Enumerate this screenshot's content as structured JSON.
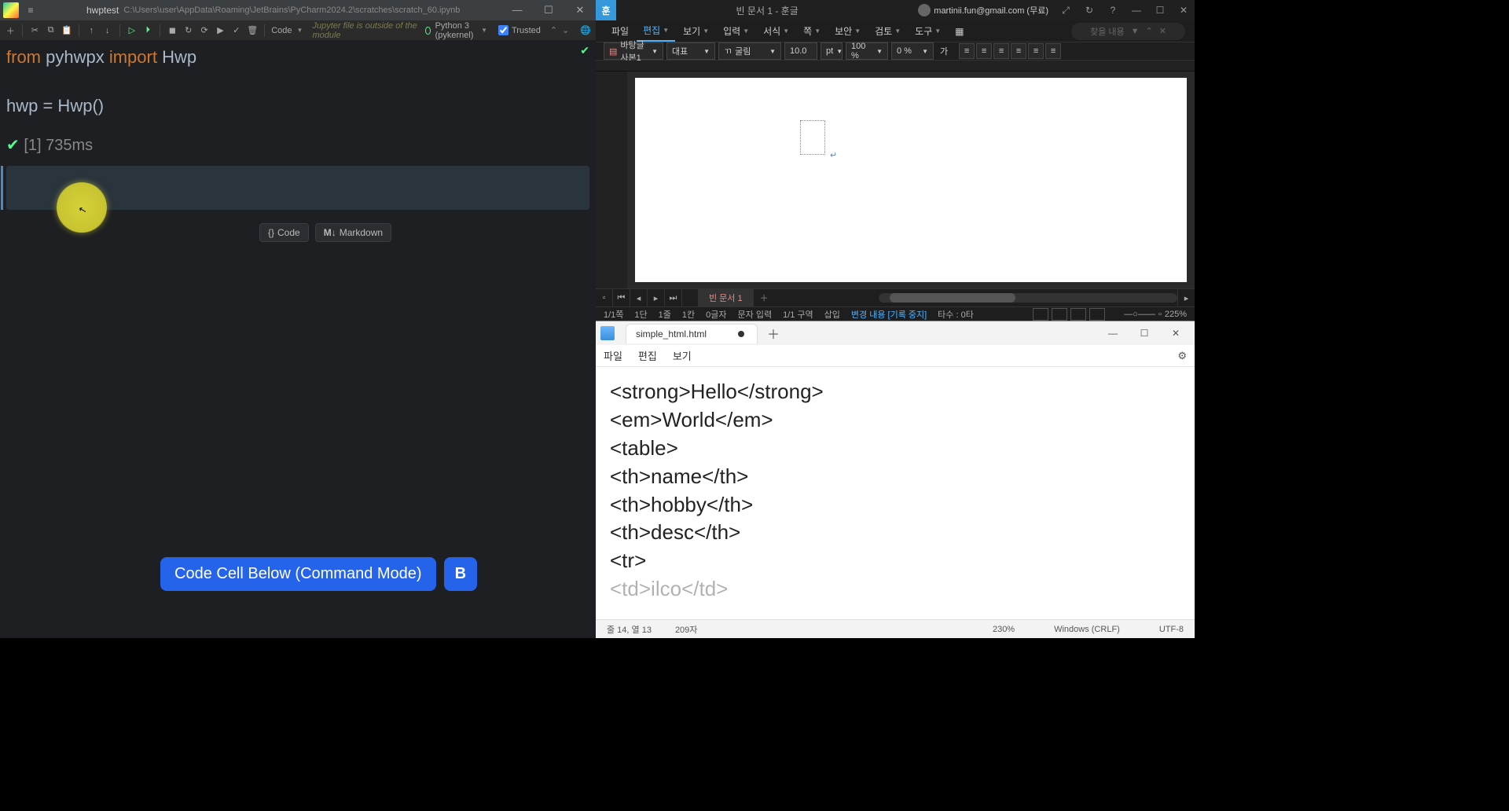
{
  "pycharm": {
    "tab_name": "hwptest",
    "path": "C:\\Users\\user\\AppData\\Roaming\\JetBrains\\PyCharm2024.2\\scratches\\scratch_60.ipynb",
    "toolbar": {
      "code_dropdown": "Code",
      "warning": "Jupyter file is outside of the module",
      "kernel": "Python 3 (pykernel)",
      "trusted": "Trusted"
    },
    "code": {
      "line1_kw1": "from",
      "line1_mod": "pyhwpx",
      "line1_kw2": "import",
      "line1_cls": "Hwp",
      "line3": "hwp = Hwp()",
      "exec_meta": "[1] 735ms"
    },
    "addcell": {
      "code": "Code",
      "markdown": "Markdown"
    },
    "hint": {
      "label": "Code Cell Below (Command Mode)",
      "key": "B"
    }
  },
  "hwp": {
    "title_doc": "빈 문서 1 - 훈글",
    "user": "martinii.fun@gmail.com (무료)",
    "menu": {
      "file": "파일",
      "edit": "편집",
      "view": "보기",
      "input": "입력",
      "format": "서식",
      "shape": "쪽",
      "security": "보안",
      "review": "검토",
      "tools": "도구",
      "pill": "찾을 내용"
    },
    "fmt": {
      "style": "바탕글 사본1",
      "para": "대표",
      "font": "굴림",
      "size": "10.0",
      "unit": "pt",
      "zoom": "100 %",
      "charspace": "0 %",
      "ga": "가"
    },
    "tabs": {
      "doc": "빈 문서 1"
    },
    "status": {
      "page": "1/1쪽",
      "dan": "1단",
      "line": "1줄",
      "col": "1칸",
      "chars": "0글자",
      "input": "문자 입력",
      "section": "1/1 구역",
      "insert": "삽입",
      "record": "변경 내용 [기록 중지]",
      "typos": "타수 : 0타",
      "zoom": "225%"
    }
  },
  "notepad": {
    "filename": "simple_html.html",
    "menu": {
      "file": "파일",
      "edit": "편집",
      "view": "보기"
    },
    "lines": [
      "<strong>Hello</strong>",
      "<em>World</em>",
      "",
      "<table>",
      "<th>name</th>",
      "<th>hobby</th>",
      "<th>desc</th>",
      "<tr>",
      "<td>ilco</td>"
    ],
    "status": {
      "pos": "줄 14, 열 13",
      "chars": "209자",
      "zoom": "230%",
      "eol": "Windows (CRLF)",
      "enc": "UTF-8"
    }
  }
}
